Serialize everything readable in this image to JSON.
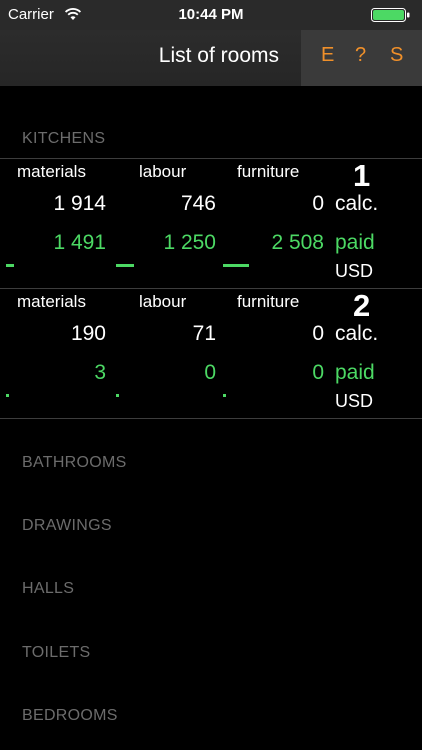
{
  "status_bar": {
    "carrier": "Carrier",
    "time": "10:44 PM",
    "battery_color": "#4cd964"
  },
  "nav": {
    "title": "List of rooms",
    "actions": {
      "e": "E",
      "help": "?",
      "s": "S"
    },
    "accent_color": "#f0902a"
  },
  "sections": {
    "kitchens": "KITCHENS",
    "bathrooms": "BATHROOMS",
    "drawings": "DRAWINGS",
    "halls": "HALLS",
    "toilets": "TOILETS",
    "bedrooms": "BEDROOMS"
  },
  "columns": {
    "materials": "materials",
    "labour": "labour",
    "furniture": "furniture"
  },
  "row_labels": {
    "calc": "calc.",
    "paid": "paid",
    "currency": "USD"
  },
  "rooms": [
    {
      "number": "1",
      "calc": {
        "materials": "1 914",
        "labour": "746",
        "furniture": "0"
      },
      "paid": {
        "materials": "1 491",
        "labour": "1 250",
        "furniture": "2 508"
      },
      "paid_ratio": {
        "materials": 0.78,
        "labour": 1.68,
        "furniture": 2.5
      }
    },
    {
      "number": "2",
      "calc": {
        "materials": "190",
        "labour": "71",
        "furniture": "0"
      },
      "paid": {
        "materials": "3",
        "labour": "0",
        "furniture": "0"
      },
      "paid_ratio": {
        "materials": 0.02,
        "labour": 0,
        "furniture": 0
      }
    }
  ]
}
